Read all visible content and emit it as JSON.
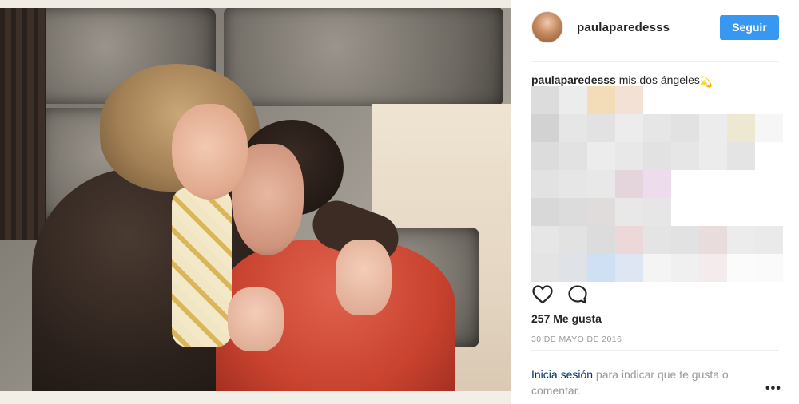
{
  "post": {
    "username": "paulaparedesss",
    "follow_label": "Seguir",
    "caption_user": "paulaparedesss",
    "caption_text": "mis dos ángeles",
    "caption_emoji": "💫",
    "likes": "257 Me gusta",
    "date": "30 DE MAYO DE 2016"
  },
  "footer": {
    "login_link": "Inicia sesión",
    "login_rest": " para indicar que te gusta o comentar."
  },
  "icons": {
    "like": "heart-icon",
    "comment": "comment-icon",
    "more": "more-options-icon"
  },
  "colors": {
    "accent": "#3897f0",
    "link": "#003569",
    "muted": "#999999",
    "text": "#262626"
  }
}
